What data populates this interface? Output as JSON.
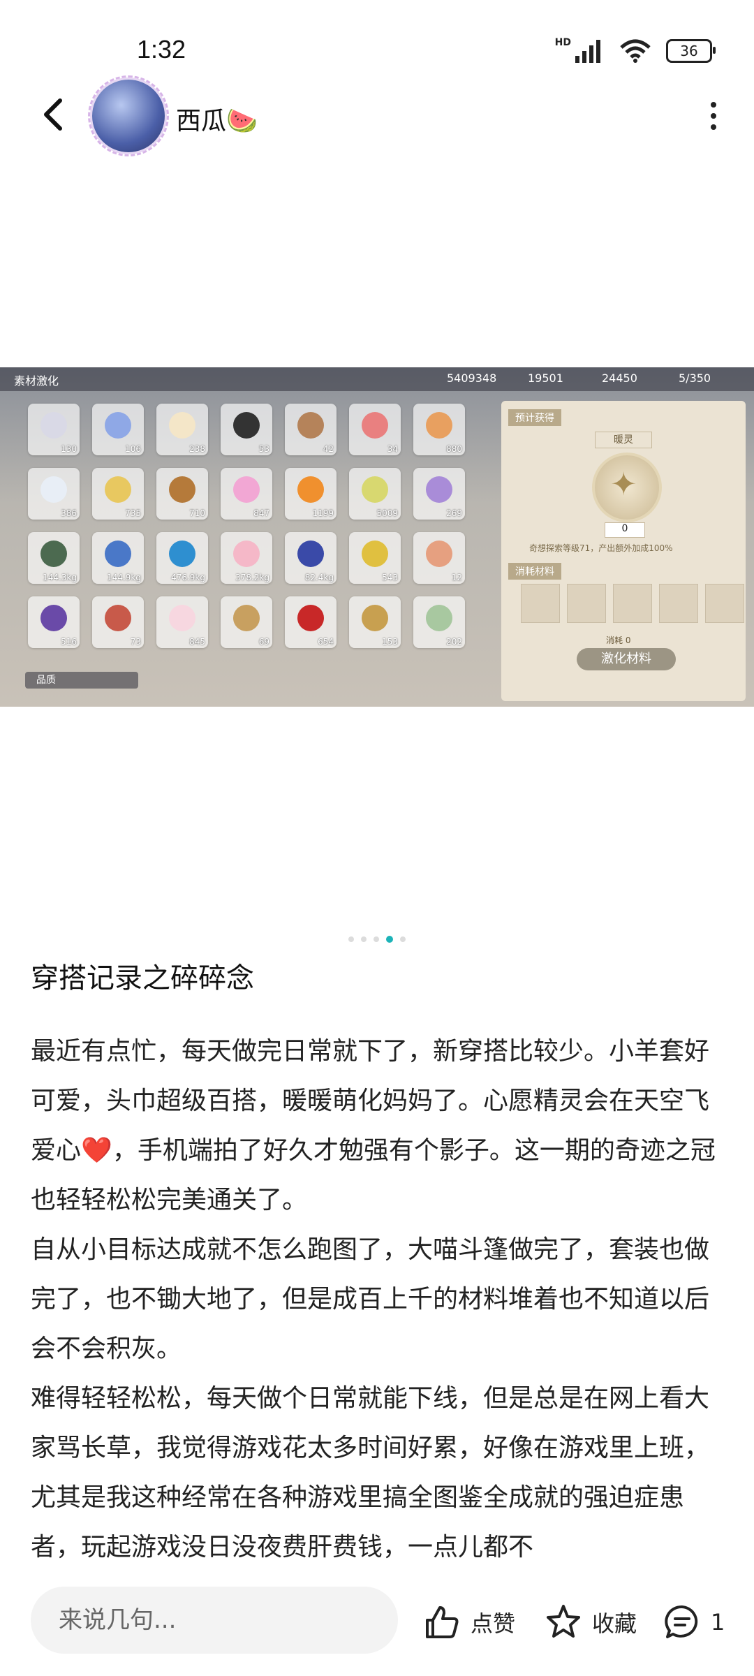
{
  "status": {
    "time": "1:32",
    "hd": "HD",
    "battery": "36"
  },
  "header": {
    "username": "西瓜🍉"
  },
  "game": {
    "title": "素材激化",
    "resources": [
      "5409348",
      "19501",
      "24450",
      "5/350"
    ],
    "counts": [
      "130",
      "106",
      "238",
      "53",
      "42",
      "34",
      "880",
      "386",
      "735",
      "710",
      "847",
      "1199",
      "5009",
      "269",
      "144.3kg",
      "144.9kg",
      "476.9kg",
      "378.2kg",
      "82.4kg",
      "543",
      "12",
      "516",
      "73",
      "845",
      "69",
      "654",
      "153",
      "202"
    ],
    "item_colors": [
      "#d9d9e6",
      "#8fa8e6",
      "#f4e6c8",
      "#333333",
      "#b5835a",
      "#e98080",
      "#e8a060",
      "#e8eef6",
      "#e8c860",
      "#b57a3a",
      "#f2a7d4",
      "#f0902e",
      "#d8d870",
      "#a98cd8",
      "#4c6a50",
      "#4a78c8",
      "#2e8fd0",
      "#f5b8c8",
      "#3a4aa8",
      "#e0c040",
      "#e6a080",
      "#6a4aa8",
      "#c85a4a",
      "#f7d7e0",
      "#c8a060",
      "#c82828",
      "#c8a050",
      "#a8c8a0"
    ],
    "filter_label": "品质",
    "panel": {
      "tag": "预计获得",
      "name": "暖灵",
      "value": "0",
      "bonus": "奇想探索等级71，产出额外加成100%",
      "materials_tag": "消耗材料",
      "consume": "消耗 0",
      "button": "激化材料"
    }
  },
  "post": {
    "title": "穿搭记录之碎碎念",
    "paragraphs": [
      "最近有点忙，每天做完日常就下了，新穿搭比较少。小羊套好可爱，头巾超级百搭，暖暖萌化妈妈了。心愿精灵会在天空飞爱心❤️，手机端拍了好久才勉强有个影子。这一期的奇迹之冠也轻轻松松完美通关了。",
      "自从小目标达成就不怎么跑图了，大喵斗篷做完了，套装也做完了，也不锄大地了，但是成百上千的材料堆着也不知道以后会不会积灰。",
      "难得轻轻松松，每天做个日常就能下线，但是总是在网上看大家骂长草，我觉得游戏花太多时间好累，好像在游戏里上班，尤其是我这种经常在各种游戏里搞全图鉴全成就的强迫症患者，玩起游戏没日没夜费肝费钱，一点儿都不"
    ]
  },
  "bottom": {
    "comment_placeholder": "来说几句...",
    "like_label": "点赞",
    "fav_label": "收藏",
    "comment_count": "1"
  },
  "pager": {
    "total": 5,
    "active": 3
  }
}
